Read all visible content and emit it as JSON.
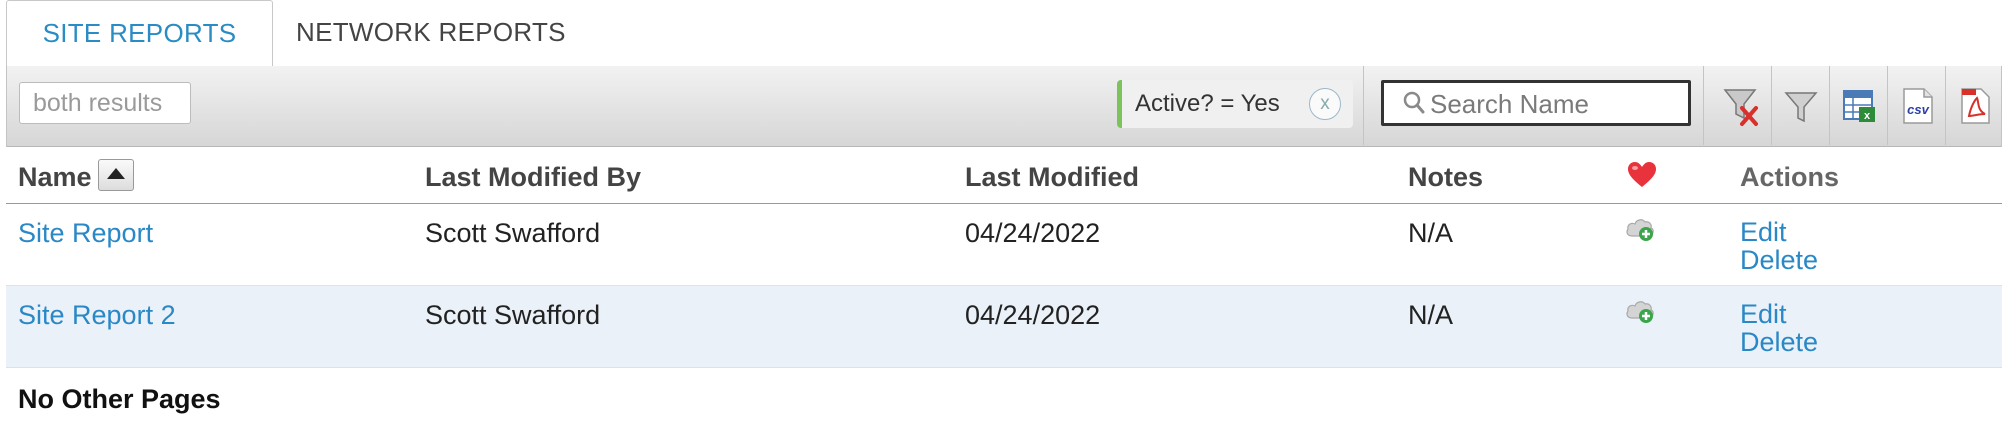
{
  "tabs": [
    {
      "label": "SITE REPORTS",
      "active": true
    },
    {
      "label": "NETWORK REPORTS",
      "active": false
    }
  ],
  "toolbar": {
    "results_label": "both results",
    "filter_chip": {
      "label": "Active? = Yes",
      "remove_label": "x"
    },
    "search": {
      "placeholder": "Search Name",
      "value": ""
    },
    "buttons": [
      {
        "name": "clear-filters-button",
        "icon": "funnel-x-icon"
      },
      {
        "name": "filter-button",
        "icon": "funnel-icon"
      },
      {
        "name": "export-excel-button",
        "icon": "excel-icon"
      },
      {
        "name": "export-csv-button",
        "icon": "csv-icon",
        "label": "csv"
      },
      {
        "name": "export-pdf-button",
        "icon": "pdf-icon"
      }
    ]
  },
  "table": {
    "columns": {
      "name": "Name",
      "last_modified_by": "Last Modified By",
      "last_modified": "Last Modified",
      "notes": "Notes",
      "favorite": "heart-icon",
      "actions": "Actions"
    },
    "rows": [
      {
        "name": "Site Report",
        "last_modified_by": "Scott Swafford",
        "last_modified": "04/24/2022",
        "notes": "N/A",
        "edit": "Edit",
        "delete": "Delete"
      },
      {
        "name": "Site Report 2",
        "last_modified_by": "Scott Swafford",
        "last_modified": "04/24/2022",
        "notes": "N/A",
        "edit": "Edit",
        "delete": "Delete"
      }
    ]
  },
  "footer": {
    "pagination_text": "No Other Pages"
  },
  "colors": {
    "accent": "#2a88c6",
    "chip_border": "#7cc35c",
    "row_alt": "#eaf1f8",
    "favorite_red": "#e8323c"
  }
}
